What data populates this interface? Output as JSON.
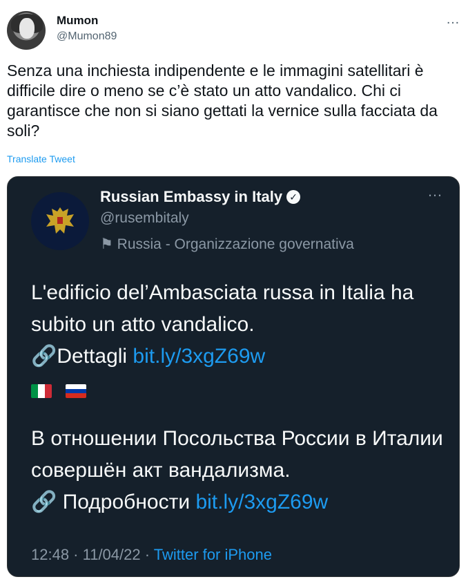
{
  "tweet": {
    "author_name": "Mumon",
    "author_handle": "@Mumon89",
    "more_icon": "…",
    "text": "Senza una inchiesta indipendente e le immagini satellitari è difficile dire o meno se c’è stato un atto vandalico. Chi ci garantisce che non si siano gettati la vernice sulla facciata da soli?",
    "translate_label": "Translate Tweet"
  },
  "quoted": {
    "name": "Russian Embassy in Italy",
    "handle": "@rusembitaly",
    "label": "Russia - Organizzazione governativa",
    "more_icon": "…",
    "it_text_a": "L'edificio del’Ambasciata russa in Italia ha subito un atto vandalico.",
    "it_details": "Dettagli",
    "it_link": "bit.ly/3xgZ69w",
    "ru_text_a": "В отношении Посольства России в Италии совершён акт вандализма.",
    "ru_details": "Подробности",
    "ru_link": "bit.ly/3xgZ69w",
    "timestamp": "12:48 · 11/04/22 · ",
    "source": "Twitter for iPhone",
    "colors": {
      "card_bg": "#15202b",
      "link": "#1d9bf0",
      "muted": "#8b98a5"
    }
  }
}
